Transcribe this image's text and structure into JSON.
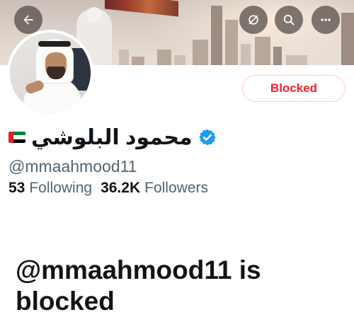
{
  "header": {
    "back_icon": "arrow-left-icon",
    "right_icons": [
      "hide-icon",
      "search-icon",
      "more-icon"
    ]
  },
  "profile": {
    "display_name": "محمود البلوشي",
    "flag_icon": "uae-flag-icon",
    "verified_icon": "verified-badge-icon",
    "handle": "@mmaahmood11",
    "following_count": "53",
    "following_label": "Following",
    "followers_count": "36.2K",
    "followers_label": "Followers"
  },
  "actions": {
    "blocked_label": "Blocked"
  },
  "blocked_notice": {
    "title": "@mmaahmood11 is blocked"
  },
  "colors": {
    "accent_red": "#f4212e",
    "verified_blue": "#1d9bf0",
    "secondary_text": "#536471",
    "primary_text": "#0f1419"
  }
}
